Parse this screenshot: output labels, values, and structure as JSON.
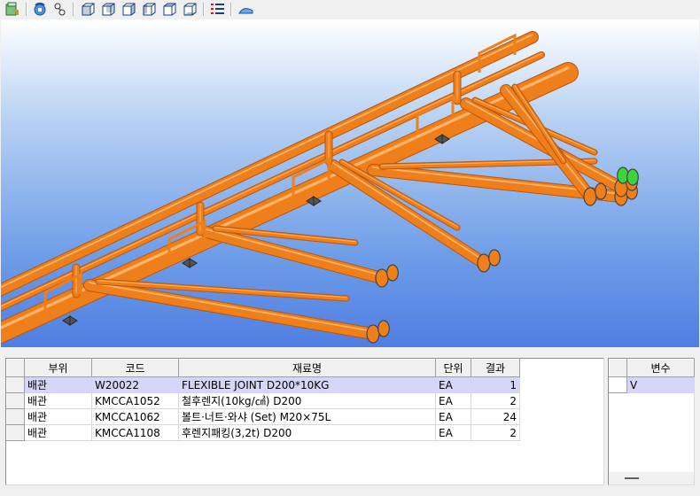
{
  "toolbar": {
    "icons": [
      "export-icon",
      "rotate-view-icon",
      "pan-icon",
      "view-front-icon",
      "view-back-icon",
      "view-left-icon",
      "view-right-icon",
      "view-top-icon",
      "view-bottom-icon",
      "list-icon",
      "hill-icon"
    ]
  },
  "colors": {
    "pipe": "#ef7f1a",
    "pipe_dark": "#b8560c",
    "selected": "#3ed33e"
  },
  "materials": {
    "columns": [
      "부위",
      "코드",
      "재료명",
      "단위",
      "결과"
    ],
    "rows": [
      {
        "part": "배관",
        "code": "W20022",
        "name": "FLEXIBLE JOINT  D200*10KG",
        "unit": "EA",
        "qty": "1"
      },
      {
        "part": "배관",
        "code": "KMCCA1052",
        "name": "철후렌지(10kg/㎠)  D200",
        "unit": "EA",
        "qty": "2"
      },
      {
        "part": "배관",
        "code": "KMCCA1062",
        "name": "볼트·너트·와샤 (Set)  M20×75L",
        "unit": "EA",
        "qty": "24"
      },
      {
        "part": "배관",
        "code": "KMCCA1108",
        "name": "후렌지패킹(3,2t)  D200",
        "unit": "EA",
        "qty": "2"
      }
    ]
  },
  "variables": {
    "header": "변수",
    "rows": [
      {
        "value": "V"
      }
    ]
  }
}
